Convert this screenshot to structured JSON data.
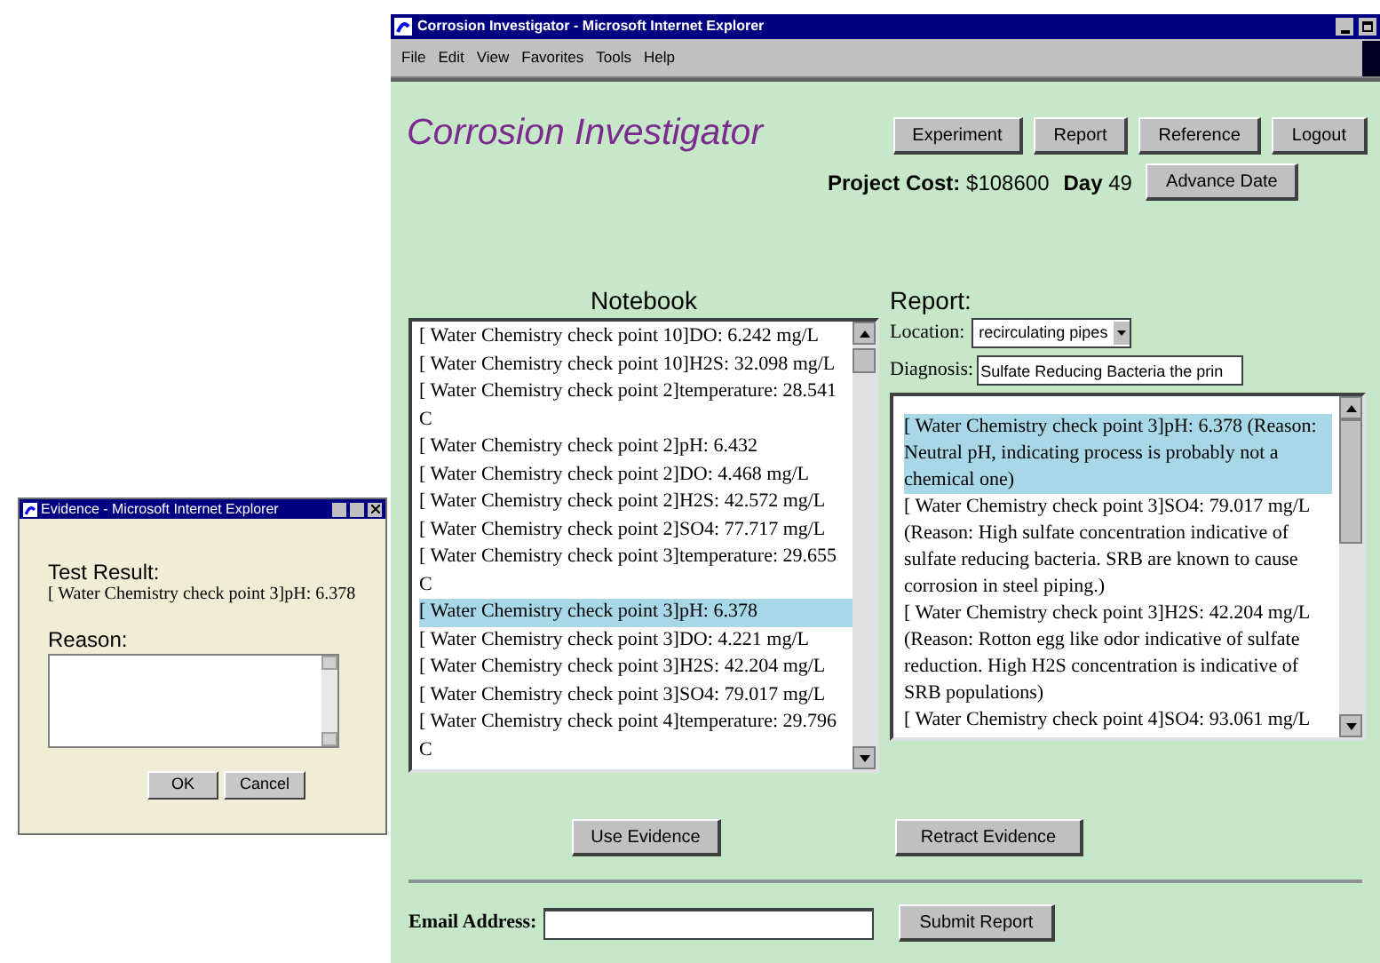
{
  "browser": {
    "title": "Corrosion Investigator - Microsoft Internet Explorer",
    "menu": [
      "File",
      "Edit",
      "View",
      "Favorites",
      "Tools",
      "Help"
    ]
  },
  "app_title": "Corrosion Investigator",
  "nav_buttons": [
    "Experiment",
    "Report",
    "Reference",
    "Logout"
  ],
  "project_cost": {
    "label": "Project Cost:",
    "value": "$108600"
  },
  "day": {
    "label": "Day",
    "value": "49"
  },
  "advance_button": "Advance Date",
  "notebook": {
    "title": "Notebook",
    "items": [
      {
        "text": "[ Water Chemistry check point 10]DO: 6.242 mg/L",
        "selected": false
      },
      {
        "text": "[ Water Chemistry check point 10]H2S: 32.098 mg/L",
        "selected": false
      },
      {
        "text": "[ Water Chemistry check point 2]temperature: 28.541 C",
        "selected": false
      },
      {
        "text": "[ Water Chemistry check point 2]pH: 6.432",
        "selected": false
      },
      {
        "text": "[ Water Chemistry check point 2]DO: 4.468 mg/L",
        "selected": false
      },
      {
        "text": "[ Water Chemistry check point 2]H2S: 42.572 mg/L",
        "selected": false
      },
      {
        "text": "[ Water Chemistry check point 2]SO4: 77.717 mg/L",
        "selected": false
      },
      {
        "text": "[ Water Chemistry check point 3]temperature: 29.655 C",
        "selected": false
      },
      {
        "text": "[ Water Chemistry check point 3]pH: 6.378",
        "selected": true
      },
      {
        "text": "[ Water Chemistry check point 3]DO: 4.221 mg/L",
        "selected": false
      },
      {
        "text": "[ Water Chemistry check point 3]H2S: 42.204 mg/L",
        "selected": false
      },
      {
        "text": "[ Water Chemistry check point 3]SO4: 79.017 mg/L",
        "selected": false
      },
      {
        "text": "[ Water Chemistry check point 4]temperature: 29.796 C",
        "selected": false
      }
    ]
  },
  "report": {
    "title": "Report:",
    "location": {
      "label": "Location:",
      "value": "recirculating pipes"
    },
    "diagnosis": {
      "label": "Diagnosis:",
      "value": "Sulfate Reducing Bacteria the prin"
    },
    "items": [
      {
        "text": "[ Water Chemistry check point 3]pH: 6.378 (Reason: Neutral pH, indicating process is probably not a chemical one)",
        "selected": true
      },
      {
        "text": "[ Water Chemistry check point 3]SO4: 79.017 mg/L (Reason: High sulfate concentration indicative of sulfate reducing bacteria. SRB are known to cause corrosion in steel piping.)",
        "selected": false
      },
      {
        "text": "[ Water Chemistry check point 3]H2S: 42.204 mg/L (Reason: Rotton egg like odor indicative of sulfate reduction. High H2S concentration is indicative of SRB populations)",
        "selected": false
      },
      {
        "text": "[ Water Chemistry check point 4]SO4: 93.061 mg/L",
        "selected": false
      }
    ]
  },
  "use_button": "Use Evidence",
  "retract_button": "Retract Evidence",
  "email": {
    "label": "Email Address:"
  },
  "submit_button": "Submit Report",
  "dialog": {
    "title": "Evidence - Microsoft Internet Explorer",
    "result_label": "Test Result:",
    "result": "[ Water Chemistry check point 3]pH: 6.378",
    "reason_label": "Reason:",
    "buttons": [
      "OK",
      "Cancel"
    ]
  }
}
